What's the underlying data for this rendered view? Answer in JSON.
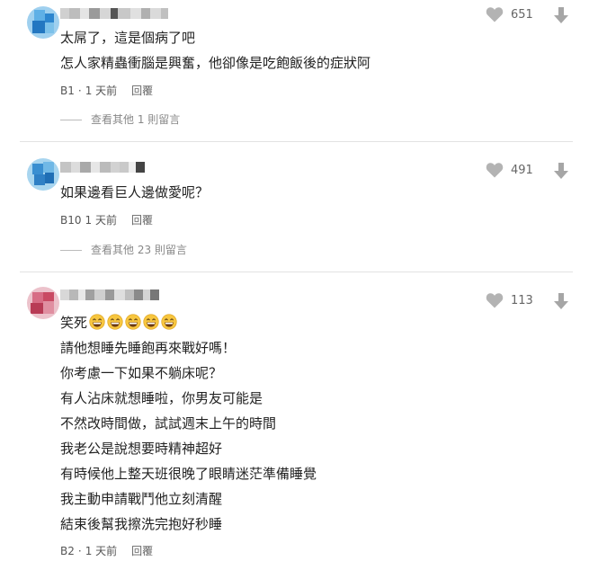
{
  "comments": [
    {
      "author_redacted": true,
      "lines": [
        "太屌了，這是個病了吧",
        "怎人家精蟲衝腦是興奮，他卻像是吃飽飯後的症狀阿"
      ],
      "floor": "B1",
      "time": "1 天前",
      "reply_label": "回覆",
      "likes": "651",
      "more_replies": "查看其他 1 則留言",
      "avatar_color": "#3a8fd1"
    },
    {
      "author_redacted": true,
      "lines": [
        "如果邊看巨人邊做愛呢？"
      ],
      "floor": "B10",
      "time": "1 天前",
      "reply_label": "回覆",
      "likes": "491",
      "more_replies": "查看其他 23 則留言",
      "avatar_color": "#3a8fd1"
    },
    {
      "author_redacted": true,
      "lines": [
        "笑死",
        "請他想睡先睡飽再來戰好嗎！",
        "你考慮一下如果不躺床呢？",
        "有人沾床就想睡啦，你男友可能是",
        "不然改時間做，試試週末上午的時間",
        "我老公是說想要時精神超好",
        "有時候他上整天班很晚了眼睛迷茫準備睡覺",
        "我主動申請戰鬥他立刻清醒",
        "結束後幫我擦洗完抱好秒睡"
      ],
      "floor": "B2",
      "time": "1 天前",
      "reply_label": "回覆",
      "likes": "113",
      "avatar_color": "#c94a63",
      "emoji_count": 5
    }
  ],
  "icons": {
    "like": "heart-icon",
    "dislike": "down-arrow-icon",
    "emoji": "grinning-face-emoji"
  }
}
